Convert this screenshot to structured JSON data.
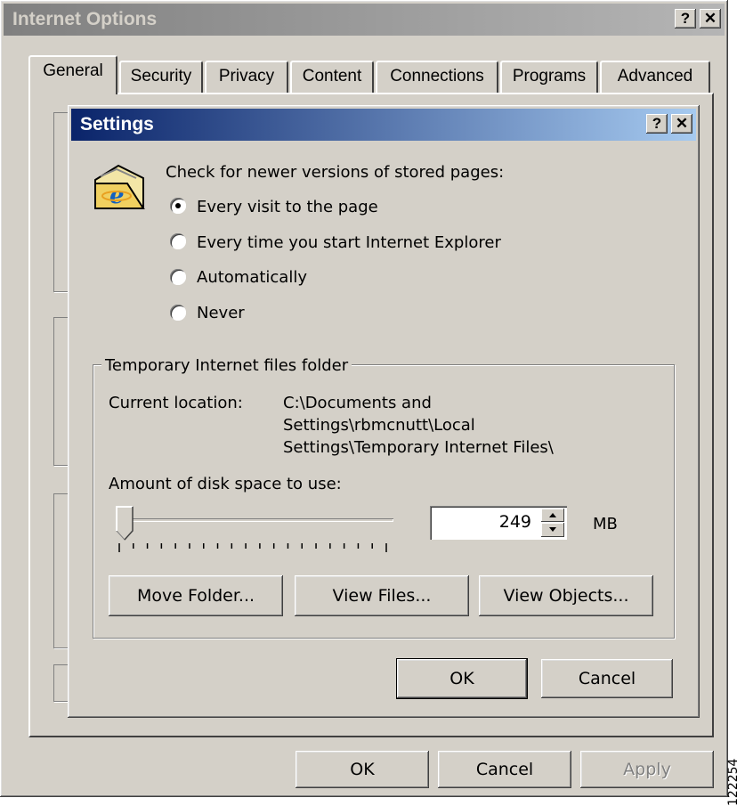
{
  "outer": {
    "title": "Internet Options",
    "help_label": "?",
    "close_label": "✕",
    "tabs": [
      "General",
      "Security",
      "Privacy",
      "Content",
      "Connections",
      "Programs",
      "Advanced"
    ],
    "buttons": {
      "ok": "OK",
      "cancel": "Cancel",
      "apply": "Apply"
    }
  },
  "dialog": {
    "title": "Settings",
    "help_label": "?",
    "close_label": "✕",
    "icon": "ie-folder-icon",
    "check_label": "Check for newer versions of stored pages:",
    "radio_options": [
      "Every visit to the page",
      "Every time you start Internet Explorer",
      "Automatically",
      "Never"
    ],
    "selected_option": "Every visit to the page",
    "group_label": "Temporary Internet files folder",
    "location_label": "Current location:",
    "location_lines": [
      "C:\\Documents and",
      "Settings\\rbmcnutt\\Local",
      "Settings\\Temporary Internet Files\\"
    ],
    "disk_label": "Amount of disk space to use:",
    "disk_value": "249",
    "disk_unit": "MB",
    "slider_level": 0.02,
    "buttons": {
      "move_folder": "Move Folder...",
      "view_files": "View Files...",
      "view_objects": "View Objects...",
      "ok": "OK",
      "cancel": "Cancel"
    }
  },
  "side_text": "122254",
  "colors": {
    "face": "#d4d0c8",
    "active_title": "#0a246a",
    "inactive_title": "#808080"
  }
}
